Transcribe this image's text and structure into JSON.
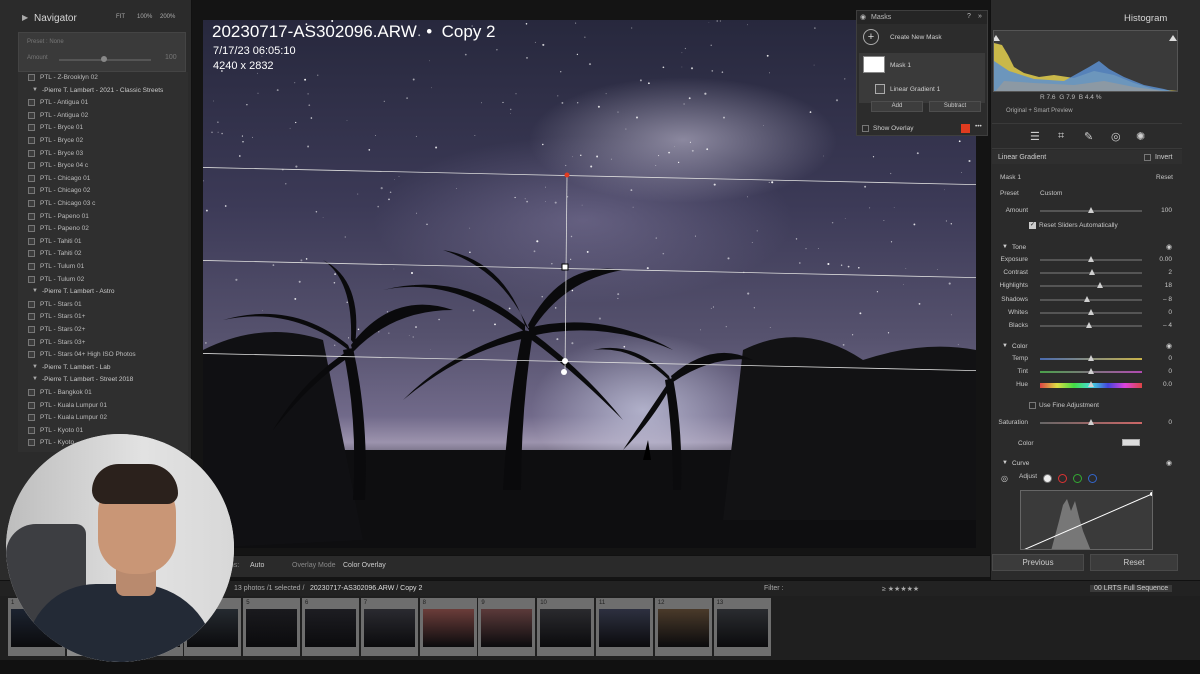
{
  "colors": {
    "accent_red": "#e03b1f",
    "panel": "#2b2b2b",
    "photo_bg": "#141414"
  },
  "navigator": {
    "title": "Navigator",
    "zoom_options": [
      "FIT",
      "100%",
      "200%"
    ],
    "preset_label": "Preset : None",
    "amount_label": "Amount",
    "amount_value": "100"
  },
  "presets": [
    {
      "type": "item",
      "label": "PTL - Z-Brooklyn 02"
    },
    {
      "type": "group",
      "label": "-Pierre T. Lambert - 2021 - Classic Streets"
    },
    {
      "type": "item",
      "label": "PTL - Antigua 01"
    },
    {
      "type": "item",
      "label": "PTL - Antigua 02"
    },
    {
      "type": "item",
      "label": "PTL - Bryce 01"
    },
    {
      "type": "item",
      "label": "PTL - Bryce 02"
    },
    {
      "type": "item",
      "label": "PTL - Bryce 03"
    },
    {
      "type": "item",
      "label": "PTL - Bryce 04 c"
    },
    {
      "type": "item",
      "label": "PTL - Chicago 01"
    },
    {
      "type": "item",
      "label": "PTL - Chicago 02"
    },
    {
      "type": "item",
      "label": "PTL - Chicago 03 c"
    },
    {
      "type": "item",
      "label": "PTL - Papeno 01"
    },
    {
      "type": "item",
      "label": "PTL - Papeno 02"
    },
    {
      "type": "item",
      "label": "PTL - Tahiti 01"
    },
    {
      "type": "item",
      "label": "PTL - Tahiti 02"
    },
    {
      "type": "item",
      "label": "PTL - Tulum 01"
    },
    {
      "type": "item",
      "label": "PTL - Tulum 02"
    },
    {
      "type": "group",
      "label": "-Pierre T. Lambert - Astro"
    },
    {
      "type": "item",
      "label": "PTL - Stars 01"
    },
    {
      "type": "item",
      "label": "PTL - Stars 01+"
    },
    {
      "type": "item",
      "label": "PTL - Stars 02+"
    },
    {
      "type": "item",
      "label": "PTL - Stars 03+"
    },
    {
      "type": "item",
      "label": "PTL - Stars 04+ High ISO Photos"
    },
    {
      "type": "group",
      "label": "-Pierre T. Lambert - Lab"
    },
    {
      "type": "group",
      "label": "-Pierre T. Lambert - Street 2018"
    },
    {
      "type": "item",
      "label": "PTL - Bangkok 01"
    },
    {
      "type": "item",
      "label": "PTL - Kuala Lumpur 01"
    },
    {
      "type": "item",
      "label": "PTL - Kuala Lumpur 02"
    },
    {
      "type": "item",
      "label": "PTL - Kyoto 01"
    },
    {
      "type": "item",
      "label": "PTL - Kyoto"
    }
  ],
  "photo": {
    "filename": "20230717-AS302096.ARW",
    "separator": "•",
    "copy": "Copy 2",
    "date": "7/17/23 06:05:10",
    "dimensions": "4240 x 2832"
  },
  "toolbar": {
    "mask_overlay_label": "ons:",
    "mask_overlay_value": "Auto",
    "overlay_mode_label": "Overlay Mode",
    "overlay_mode_value": "Color Overlay"
  },
  "masks": {
    "title": "Masks",
    "create_new": "Create New Mask",
    "mask1": "Mask 1",
    "component": "Linear Gradient 1",
    "add": "Add",
    "subtract": "Subtract",
    "show_overlay": "Show Overlay"
  },
  "histogram": {
    "title": "Histogram",
    "r_label": "R",
    "r": "7.6",
    "g_label": "G",
    "g": "7.9",
    "b_label": "B",
    "b": "4.4",
    "unit": "%",
    "subtitle": "Original + Smart Preview"
  },
  "mask_panel": {
    "type": "Linear Gradient",
    "invert": "Invert",
    "mask_name": "Mask 1",
    "reset": "Reset",
    "preset_label": "Preset",
    "preset_value": "Custom",
    "amount_label": "Amount",
    "amount_value": "100",
    "reset_auto": "Reset Sliders Automatically"
  },
  "tone": {
    "title": "Tone",
    "sliders": [
      {
        "label": "Exposure",
        "value": "0.00",
        "pos": 0.5
      },
      {
        "label": "Contrast",
        "value": "2",
        "pos": 0.51
      },
      {
        "label": "Highlights",
        "value": "18",
        "pos": 0.59
      },
      {
        "label": "Shadows",
        "value": "– 8",
        "pos": 0.46
      },
      {
        "label": "Whites",
        "value": "0",
        "pos": 0.5
      },
      {
        "label": "Blacks",
        "value": "– 4",
        "pos": 0.48
      }
    ]
  },
  "color": {
    "title": "Color",
    "sliders": [
      {
        "label": "Temp",
        "value": "0",
        "pos": 0.5
      },
      {
        "label": "Tint",
        "value": "0",
        "pos": 0.5
      },
      {
        "label": "Hue",
        "value": "0.0",
        "pos": 0.5
      }
    ],
    "fine_adjust": "Use Fine Adjustment",
    "saturation_label": "Saturation",
    "saturation_value": "0",
    "color_label": "Color"
  },
  "curve": {
    "title": "Curve",
    "adjust_label": "Adjust"
  },
  "buttons": {
    "previous": "Previous",
    "reset": "Reset"
  },
  "filmstrip_bar": {
    "info": "13 photos /1 selected /",
    "path": "20230717-AS302096.ARW / Copy 2",
    "filter_label": "Filter :",
    "stars": "≥ ★★★★★",
    "sequence": "00 LRTS Full Sequence"
  },
  "filmstrip": [
    {
      "n": "1"
    },
    {
      "n": "2"
    },
    {
      "n": "3"
    },
    {
      "n": "4"
    },
    {
      "n": "5"
    },
    {
      "n": "6"
    },
    {
      "n": "7"
    },
    {
      "n": "8"
    },
    {
      "n": "9"
    },
    {
      "n": "10"
    },
    {
      "n": "11"
    },
    {
      "n": "12"
    },
    {
      "n": "13"
    }
  ]
}
